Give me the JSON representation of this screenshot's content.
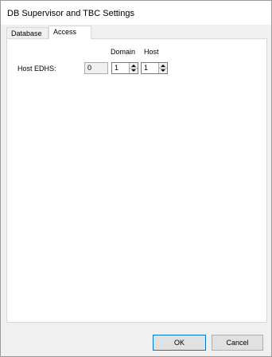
{
  "window": {
    "title": "DB Supervisor and TBC Settings"
  },
  "tabs": [
    {
      "label": "Database"
    },
    {
      "label": "Access"
    }
  ],
  "access": {
    "col_domain": "Domain",
    "col_host": "Host",
    "host_edhs_label": "Host EDHS:",
    "edhs_value": "0",
    "domain_value": "1",
    "host_value": "1"
  },
  "footer": {
    "ok_label": "OK",
    "cancel_label": "Cancel"
  },
  "icons": {
    "spin": "up-down-arrow-icon"
  }
}
